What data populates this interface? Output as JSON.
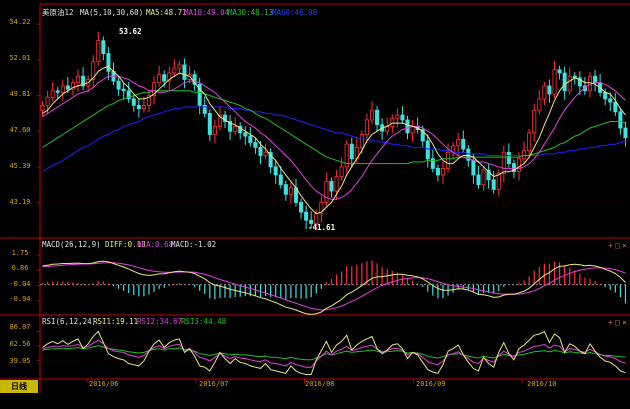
{
  "header": {
    "title": "美原油12",
    "ma_label": "MA(5,10,30,60)",
    "ma5": "MA5:48.71",
    "ma10": "MA10:49.04",
    "ma30": "MA30:48.13",
    "ma60": "MA60:46.98"
  },
  "macd_header": {
    "label": "MACD(26,12,9)",
    "diff": "DIFF:0.13",
    "dea": "DEA:0.68",
    "macd": "MACD:-1.02"
  },
  "rsi_header": {
    "label": "RSI(6,12,24)",
    "rsi1": "RSI1:19.11",
    "rsi2": "RSI2:34.67",
    "rsi3": "RSI3:44.48"
  },
  "period_button": "日线",
  "controls": {
    "add": "+",
    "restore": "□",
    "close": "×"
  },
  "colors": {
    "up": "#ff3030",
    "down": "#40e0e0",
    "axis": "#c00000",
    "ma5": "#e8e880",
    "ma10": "#e040e0",
    "ma30": "#20c020",
    "ma60": "#2020ff",
    "label": "#e0a000"
  },
  "chart_data": [
    {
      "type": "candlestick",
      "title": "美原油12",
      "y_ticks": [
        "54.22",
        "52.01",
        "49.81",
        "47.60",
        "45.39",
        "43.19"
      ],
      "x_ticks": [
        "2016/06",
        "2016/07",
        "2016/08",
        "2016/09",
        "2016/10"
      ],
      "ylim": [
        41.0,
        54.6
      ],
      "annotations": [
        {
          "text": "53.62",
          "kind": "high"
        },
        {
          "text": "-41.61",
          "kind": "low"
        }
      ],
      "close": [
        49.2,
        49.7,
        50.1,
        50.0,
        50.4,
        50.2,
        50.6,
        51.0,
        50.4,
        50.8,
        51.9,
        53.2,
        52.4,
        51.3,
        50.7,
        50.2,
        50.1,
        49.6,
        49.2,
        49.0,
        49.2,
        49.8,
        50.6,
        51.1,
        50.7,
        51.2,
        51.5,
        51.7,
        50.8,
        51.1,
        50.5,
        49.2,
        48.7,
        47.4,
        47.9,
        48.6,
        48.2,
        47.6,
        47.9,
        47.5,
        47.3,
        46.9,
        46.6,
        46.1,
        46.3,
        45.4,
        44.9,
        44.3,
        43.7,
        44.1,
        43.2,
        42.6,
        42.1,
        41.9,
        42.5,
        43.2,
        44.5,
        43.9,
        44.8,
        45.4,
        46.8,
        45.9,
        46.6,
        47.4,
        48.3,
        48.9,
        48.0,
        47.6,
        47.9,
        48.4,
        48.6,
        48.3,
        47.5,
        47.9,
        47.7,
        47.0,
        45.9,
        45.3,
        44.9,
        45.3,
        46.3,
        46.7,
        47.1,
        46.5,
        45.8,
        44.9,
        44.3,
        45.2,
        44.6,
        44.0,
        45.0,
        46.3,
        45.6,
        45.1,
        45.9,
        46.4,
        47.5,
        48.9,
        49.6,
        50.4,
        49.9,
        51.4,
        51.2,
        50.1,
        51.0,
        50.9,
        50.4,
        50.1,
        51.0,
        50.6,
        50.0,
        49.6,
        49.4,
        48.8,
        47.8,
        47.2
      ],
      "ma5": [
        48.7,
        48.9,
        49.3,
        49.6,
        49.9,
        50.1,
        50.3,
        50.4,
        50.5,
        50.6,
        50.9,
        51.3,
        51.5,
        51.6,
        51.3,
        51.0,
        50.6,
        50.3,
        49.9,
        49.6,
        49.6,
        49.7,
        49.9,
        50.2,
        50.5,
        50.8,
        51.0,
        51.2,
        51.1,
        51.0,
        50.6,
        50.2,
        49.9,
        49.3,
        48.9,
        48.5,
        48.3,
        48.1,
        48.0,
        47.8,
        47.6,
        47.4,
        47.2,
        46.8,
        46.5,
        46.1,
        45.8,
        45.3,
        44.9,
        44.5,
        44.1,
        43.6,
        43.2,
        42.8,
        42.5,
        42.6,
        42.9,
        43.2,
        43.7,
        44.2,
        44.9,
        45.4,
        45.9,
        46.4,
        47.0,
        47.4,
        47.6,
        47.8,
        47.9,
        48.1,
        48.1,
        48.1,
        48.0,
        47.9,
        47.8,
        47.6,
        47.3,
        46.8,
        46.2,
        45.8,
        45.6,
        45.6,
        45.9,
        46.1,
        46.1,
        46.0,
        45.7,
        45.4,
        45.1,
        44.8,
        44.9,
        45.1,
        45.1,
        45.2,
        45.4,
        45.6,
        46.0,
        46.6,
        47.2,
        48.0,
        48.7,
        49.5,
        50.1,
        50.5,
        50.7,
        50.9,
        50.8,
        50.6,
        50.6,
        50.5,
        50.3,
        50.0,
        49.9,
        49.5,
        49.0,
        48.6
      ],
      "ma10": [
        48.5,
        48.7,
        48.9,
        49.1,
        49.3,
        49.5,
        49.7,
        49.9,
        50.0,
        50.1,
        50.3,
        50.6,
        50.8,
        51.0,
        51.0,
        51.0,
        50.9,
        50.8,
        50.6,
        50.4,
        50.3,
        50.1,
        50.1,
        50.0,
        50.0,
        50.1,
        50.2,
        50.4,
        50.6,
        50.7,
        50.7,
        50.6,
        50.4,
        50.2,
        50.0,
        49.7,
        49.4,
        49.1,
        48.8,
        48.5,
        48.2,
        48.0,
        47.8,
        47.5,
        47.3,
        47.0,
        46.7,
        46.4,
        46.1,
        45.8,
        45.4,
        45.0,
        44.6,
        44.2,
        43.9,
        43.7,
        43.5,
        43.4,
        43.4,
        43.5,
        43.7,
        44.0,
        44.4,
        44.8,
        45.3,
        45.8,
        46.2,
        46.6,
        47.0,
        47.3,
        47.5,
        47.7,
        47.8,
        47.9,
        47.9,
        47.8,
        47.6,
        47.4,
        47.1,
        46.8,
        46.5,
        46.3,
        46.1,
        46.0,
        45.9,
        45.8,
        45.7,
        45.7,
        45.6,
        45.5,
        45.4,
        45.3,
        45.3,
        45.3,
        45.3,
        45.4,
        45.6,
        45.9,
        46.3,
        46.8,
        47.3,
        47.8,
        48.4,
        48.9,
        49.3,
        49.7,
        50.0,
        50.3,
        50.5,
        50.6,
        50.6,
        50.5,
        50.3,
        50.1,
        49.8,
        49.5
      ],
      "ma30": [
        46.6,
        46.8,
        47.0,
        47.2,
        47.4,
        47.6,
        47.8,
        48.0,
        48.2,
        48.4,
        48.6,
        48.8,
        49.0,
        49.2,
        49.3,
        49.5,
        49.6,
        49.7,
        49.8,
        49.9,
        50.0,
        50.0,
        50.1,
        50.1,
        50.1,
        50.1,
        50.1,
        50.1,
        50.1,
        50.1,
        50.0,
        50.0,
        49.9,
        49.8,
        49.7,
        49.6,
        49.5,
        49.4,
        49.3,
        49.2,
        49.0,
        48.9,
        48.7,
        48.5,
        48.4,
        48.2,
        48.0,
        47.8,
        47.6,
        47.4,
        47.2,
        47.0,
        46.8,
        46.6,
        46.4,
        46.2,
        46.0,
        45.9,
        45.8,
        45.7,
        45.6,
        45.6,
        45.6,
        45.6,
        45.6,
        45.6,
        45.6,
        45.6,
        45.6,
        45.6,
        45.6,
        45.6,
        45.6,
        45.7,
        45.7,
        45.7,
        45.8,
        45.8,
        45.8,
        45.9,
        45.9,
        45.9,
        46.0,
        46.0,
        46.0,
        46.0,
        46.0,
        46.0,
        46.0,
        46.0,
        46.0,
        46.0,
        46.0,
        46.0,
        46.0,
        46.1,
        46.1,
        46.2,
        46.3,
        46.4,
        46.5,
        46.6,
        46.8,
        46.9,
        47.1,
        47.3,
        47.4,
        47.6,
        47.8,
        47.9,
        48.0,
        48.1,
        48.2,
        48.2,
        48.2,
        48.1
      ],
      "ma60": [
        45.1,
        45.3,
        45.5,
        45.6,
        45.8,
        46.0,
        46.2,
        46.4,
        46.6,
        46.7,
        46.9,
        47.1,
        47.3,
        47.4,
        47.6,
        47.7,
        47.9,
        48.0,
        48.1,
        48.2,
        48.4,
        48.5,
        48.6,
        48.7,
        48.8,
        48.9,
        49.0,
        49.0,
        49.1,
        49.1,
        49.1,
        49.1,
        49.1,
        49.1,
        49.1,
        49.1,
        49.1,
        49.0,
        49.0,
        49.0,
        48.9,
        48.9,
        48.8,
        48.8,
        48.7,
        48.7,
        48.6,
        48.6,
        48.5,
        48.4,
        48.3,
        48.2,
        48.1,
        48.0,
        47.9,
        47.8,
        47.7,
        47.6,
        47.5,
        47.5,
        47.4,
        47.3,
        47.2,
        47.1,
        47.1,
        47.0,
        47.0,
        46.9,
        46.9,
        46.8,
        46.8,
        46.7,
        46.7,
        46.6,
        46.6,
        46.6,
        46.5,
        46.5,
        46.5,
        46.4,
        46.4,
        46.3,
        46.3,
        46.3,
        46.2,
        46.2,
        46.2,
        46.2,
        46.1,
        46.1,
        46.1,
        46.1,
        46.1,
        46.1,
        46.1,
        46.1,
        46.1,
        46.1,
        46.1,
        46.2,
        46.2,
        46.2,
        46.3,
        46.3,
        46.4,
        46.4,
        46.5,
        46.5,
        46.6,
        46.6,
        46.7,
        46.7,
        46.8,
        46.8,
        46.9,
        46.98
      ]
    },
    {
      "type": "macd",
      "title": "MACD(26,12,9)",
      "y_ticks": [
        "1.75",
        "0.86",
        "-0.04",
        "-0.94"
      ],
      "ylim": [
        -1.6,
        2.1
      ],
      "diff": [
        1.1,
        1.15,
        1.2,
        1.22,
        1.25,
        1.25,
        1.26,
        1.27,
        1.25,
        1.24,
        1.28,
        1.36,
        1.38,
        1.34,
        1.25,
        1.14,
        1.04,
        0.92,
        0.79,
        0.66,
        0.58,
        0.55,
        0.58,
        0.64,
        0.65,
        0.7,
        0.76,
        0.8,
        0.76,
        0.74,
        0.66,
        0.5,
        0.35,
        0.12,
        -0.02,
        -0.08,
        -0.16,
        -0.27,
        -0.33,
        -0.4,
        -0.47,
        -0.56,
        -0.65,
        -0.76,
        -0.82,
        -0.94,
        -1.05,
        -1.18,
        -1.32,
        -1.38,
        -1.48,
        -1.6,
        -1.7,
        -1.74,
        -1.7,
        -1.6,
        -1.38,
        -1.24,
        -1.05,
        -0.86,
        -0.58,
        -0.44,
        -0.25,
        -0.05,
        0.18,
        0.38,
        0.46,
        0.48,
        0.52,
        0.58,
        0.62,
        0.62,
        0.56,
        0.52,
        0.47,
        0.35,
        0.16,
        -0.04,
        -0.22,
        -0.32,
        -0.32,
        -0.29,
        -0.24,
        -0.25,
        -0.31,
        -0.43,
        -0.57,
        -0.59,
        -0.65,
        -0.74,
        -0.72,
        -0.61,
        -0.56,
        -0.56,
        -0.48,
        -0.38,
        -0.2,
        0.06,
        0.31,
        0.56,
        0.71,
        0.94,
        1.08,
        1.1,
        1.17,
        1.2,
        1.18,
        1.12,
        1.14,
        1.1,
        1.02,
        0.91,
        0.8,
        0.66,
        0.43,
        0.13
      ],
      "dea": [
        1.05,
        1.07,
        1.1,
        1.12,
        1.15,
        1.17,
        1.19,
        1.21,
        1.22,
        1.22,
        1.23,
        1.26,
        1.28,
        1.3,
        1.29,
        1.26,
        1.22,
        1.16,
        1.09,
        1.0,
        0.92,
        0.84,
        0.79,
        0.76,
        0.74,
        0.73,
        0.73,
        0.75,
        0.75,
        0.75,
        0.73,
        0.68,
        0.62,
        0.52,
        0.41,
        0.31,
        0.22,
        0.12,
        0.03,
        -0.05,
        -0.14,
        -0.22,
        -0.31,
        -0.4,
        -0.49,
        -0.58,
        -0.68,
        -0.78,
        -0.89,
        -0.99,
        -1.09,
        -1.19,
        -1.29,
        -1.38,
        -1.44,
        -1.48,
        -1.46,
        -1.42,
        -1.35,
        -1.25,
        -1.12,
        -0.98,
        -0.84,
        -0.68,
        -0.51,
        -0.33,
        -0.17,
        -0.04,
        0.07,
        0.17,
        0.26,
        0.33,
        0.37,
        0.4,
        0.42,
        0.41,
        0.36,
        0.28,
        0.18,
        0.08,
        0.0,
        -0.06,
        -0.1,
        -0.13,
        -0.17,
        -0.22,
        -0.29,
        -0.35,
        -0.41,
        -0.48,
        -0.53,
        -0.55,
        -0.56,
        -0.56,
        -0.55,
        -0.51,
        -0.45,
        -0.35,
        -0.22,
        -0.06,
        0.09,
        0.26,
        0.42,
        0.55,
        0.67,
        0.78,
        0.86,
        0.91,
        0.96,
        0.99,
        0.99,
        0.98,
        0.95,
        0.89,
        0.8,
        0.68
      ]
    },
    {
      "type": "line",
      "title": "RSI(6,12,24)",
      "y_ticks": [
        "86.07",
        "62.56",
        "39.05"
      ],
      "ylim": [
        12,
        95
      ],
      "rsi1": [
        60,
        66,
        70,
        66,
        71,
        65,
        70,
        74,
        58,
        66,
        78,
        86,
        68,
        50,
        45,
        42,
        40,
        34,
        32,
        30,
        38,
        54,
        66,
        72,
        60,
        68,
        72,
        74,
        52,
        58,
        46,
        30,
        28,
        22,
        36,
        52,
        42,
        34,
        42,
        36,
        34,
        30,
        28,
        26,
        34,
        24,
        22,
        20,
        18,
        30,
        22,
        18,
        16,
        16,
        40,
        55,
        70,
        52,
        64,
        70,
        80,
        56,
        64,
        70,
        74,
        78,
        58,
        50,
        56,
        64,
        66,
        58,
        42,
        52,
        48,
        36,
        24,
        20,
        18,
        32,
        54,
        58,
        64,
        48,
        36,
        26,
        22,
        44,
        34,
        28,
        52,
        68,
        50,
        40,
        58,
        64,
        72,
        80,
        82,
        86,
        68,
        82,
        76,
        52,
        66,
        62,
        54,
        50,
        66,
        54,
        44,
        38,
        36,
        30,
        22,
        19
      ],
      "rsi2": [
        58,
        60,
        62,
        61,
        63,
        62,
        63,
        65,
        60,
        62,
        67,
        72,
        66,
        58,
        55,
        53,
        52,
        48,
        46,
        44,
        47,
        55,
        60,
        63,
        58,
        62,
        64,
        65,
        56,
        58,
        52,
        44,
        42,
        38,
        44,
        50,
        46,
        42,
        45,
        43,
        42,
        40,
        38,
        37,
        40,
        35,
        34,
        32,
        30,
        36,
        32,
        30,
        28,
        28,
        38,
        46,
        54,
        48,
        54,
        57,
        62,
        55,
        57,
        60,
        62,
        64,
        57,
        53,
        55,
        58,
        59,
        56,
        48,
        52,
        50,
        44,
        37,
        34,
        32,
        38,
        48,
        50,
        53,
        47,
        42,
        36,
        34,
        43,
        39,
        36,
        47,
        54,
        49,
        45,
        52,
        54,
        58,
        62,
        63,
        65,
        59,
        64,
        62,
        53,
        58,
        57,
        54,
        52,
        57,
        53,
        49,
        46,
        45,
        42,
        37,
        34.67
      ],
      "rsi3": [
        56,
        57,
        58,
        58,
        59,
        58,
        59,
        60,
        58,
        59,
        61,
        63,
        61,
        58,
        57,
        56,
        55,
        53,
        52,
        51,
        52,
        55,
        57,
        58,
        56,
        58,
        58,
        59,
        56,
        56,
        54,
        50,
        49,
        47,
        49,
        51,
        50,
        48,
        49,
        48,
        48,
        47,
        46,
        45,
        46,
        44,
        44,
        43,
        42,
        44,
        42,
        41,
        40,
        40,
        43,
        46,
        50,
        48,
        50,
        52,
        54,
        52,
        53,
        54,
        55,
        56,
        54,
        52,
        53,
        54,
        55,
        54,
        51,
        52,
        51,
        49,
        46,
        44,
        43,
        45,
        48,
        49,
        50,
        48,
        46,
        44,
        43,
        46,
        44,
        43,
        46,
        49,
        47,
        46,
        48,
        49,
        51,
        53,
        54,
        55,
        53,
        55,
        54,
        51,
        53,
        52,
        51,
        50,
        52,
        50,
        48,
        47,
        47,
        46,
        45,
        44.48
      ]
    }
  ]
}
